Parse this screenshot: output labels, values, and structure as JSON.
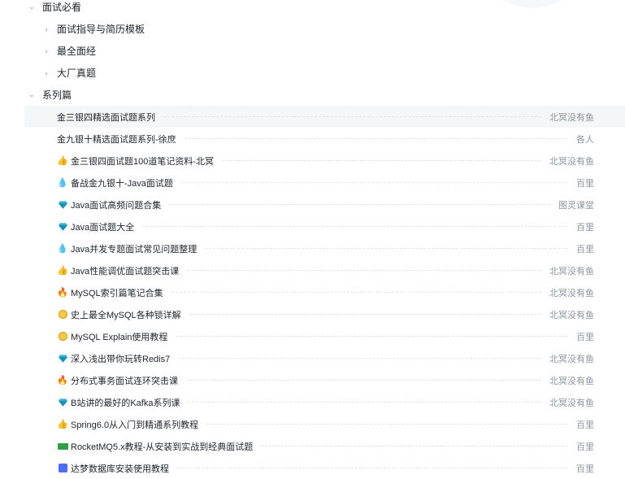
{
  "sections": [
    {
      "label": "面试必看",
      "icon": "chevron-down-icon"
    },
    {
      "label": "系列篇",
      "icon": "chevron-down-icon"
    }
  ],
  "subfolders": [
    {
      "label": "面试指导与简历模板",
      "icon": "chevron-right-icon"
    },
    {
      "label": "最全面经",
      "icon": "chevron-right-icon"
    },
    {
      "label": "大厂真题",
      "icon": "chevron-right-icon"
    }
  ],
  "items": [
    {
      "title": "金三银四精选面试题系列",
      "author": "北冥没有鱼",
      "icon": "none"
    },
    {
      "title": "金九银十精选面试题系列-徐庶",
      "author": "各人",
      "icon": "none"
    },
    {
      "title": "金三银四面试题100道笔记资料-北冥",
      "author": "北冥没有鱼",
      "icon": "thumbs-up-icon"
    },
    {
      "title": "备战金九银十-Java面试题",
      "author": "百里",
      "icon": "droplet-icon"
    },
    {
      "title": "Java面试高频问题合集",
      "author": "图灵课堂",
      "icon": "gem-icon"
    },
    {
      "title": "Java面试题大全",
      "author": "百里",
      "icon": "gem-icon"
    },
    {
      "title": "Java并发专题面试常见问题整理",
      "author": "百里",
      "icon": "droplet-icon"
    },
    {
      "title": "Java性能调优面试题突击课",
      "author": "北冥没有鱼",
      "icon": "thumbs-up-icon"
    },
    {
      "title": "MySQL索引篇笔记合集",
      "author": "北冥没有鱼",
      "icon": "fire-icon"
    },
    {
      "title": "史上最全MySQL各种锁详解",
      "author": "北冥没有鱼",
      "icon": "smile-icon"
    },
    {
      "title": "MySQL Explain使用教程",
      "author": "百里",
      "icon": "smile-icon"
    },
    {
      "title": "深入浅出带你玩转Redis7",
      "author": "北冥没有鱼",
      "icon": "gem-icon"
    },
    {
      "title": "分布式事务面试连环突击课",
      "author": "北冥没有鱼",
      "icon": "fire-icon"
    },
    {
      "title": "B站讲的最好的Kafka系列课",
      "author": "北冥没有鱼",
      "icon": "gem-icon"
    },
    {
      "title": "Spring6.0从入门到精通系列教程",
      "author": "百里",
      "icon": "thumbs-up-icon"
    },
    {
      "title": "RocketMQ5.x教程-从安装到实战到经典面试题",
      "author": "百里",
      "icon": "truck-icon"
    },
    {
      "title": "达梦数据库安装使用教程",
      "author": "百里",
      "icon": "database-icon"
    }
  ],
  "icon_glyphs": {
    "chevron_down": "⌄",
    "chevron_right": "›",
    "thumbs_up": "👍",
    "droplet": "💧",
    "fire": "🔥"
  },
  "colors": {
    "hover_bg": "#f5f6f7",
    "muted": "#8f959e",
    "text": "#1f2329",
    "gem": "#2bb5d8"
  }
}
